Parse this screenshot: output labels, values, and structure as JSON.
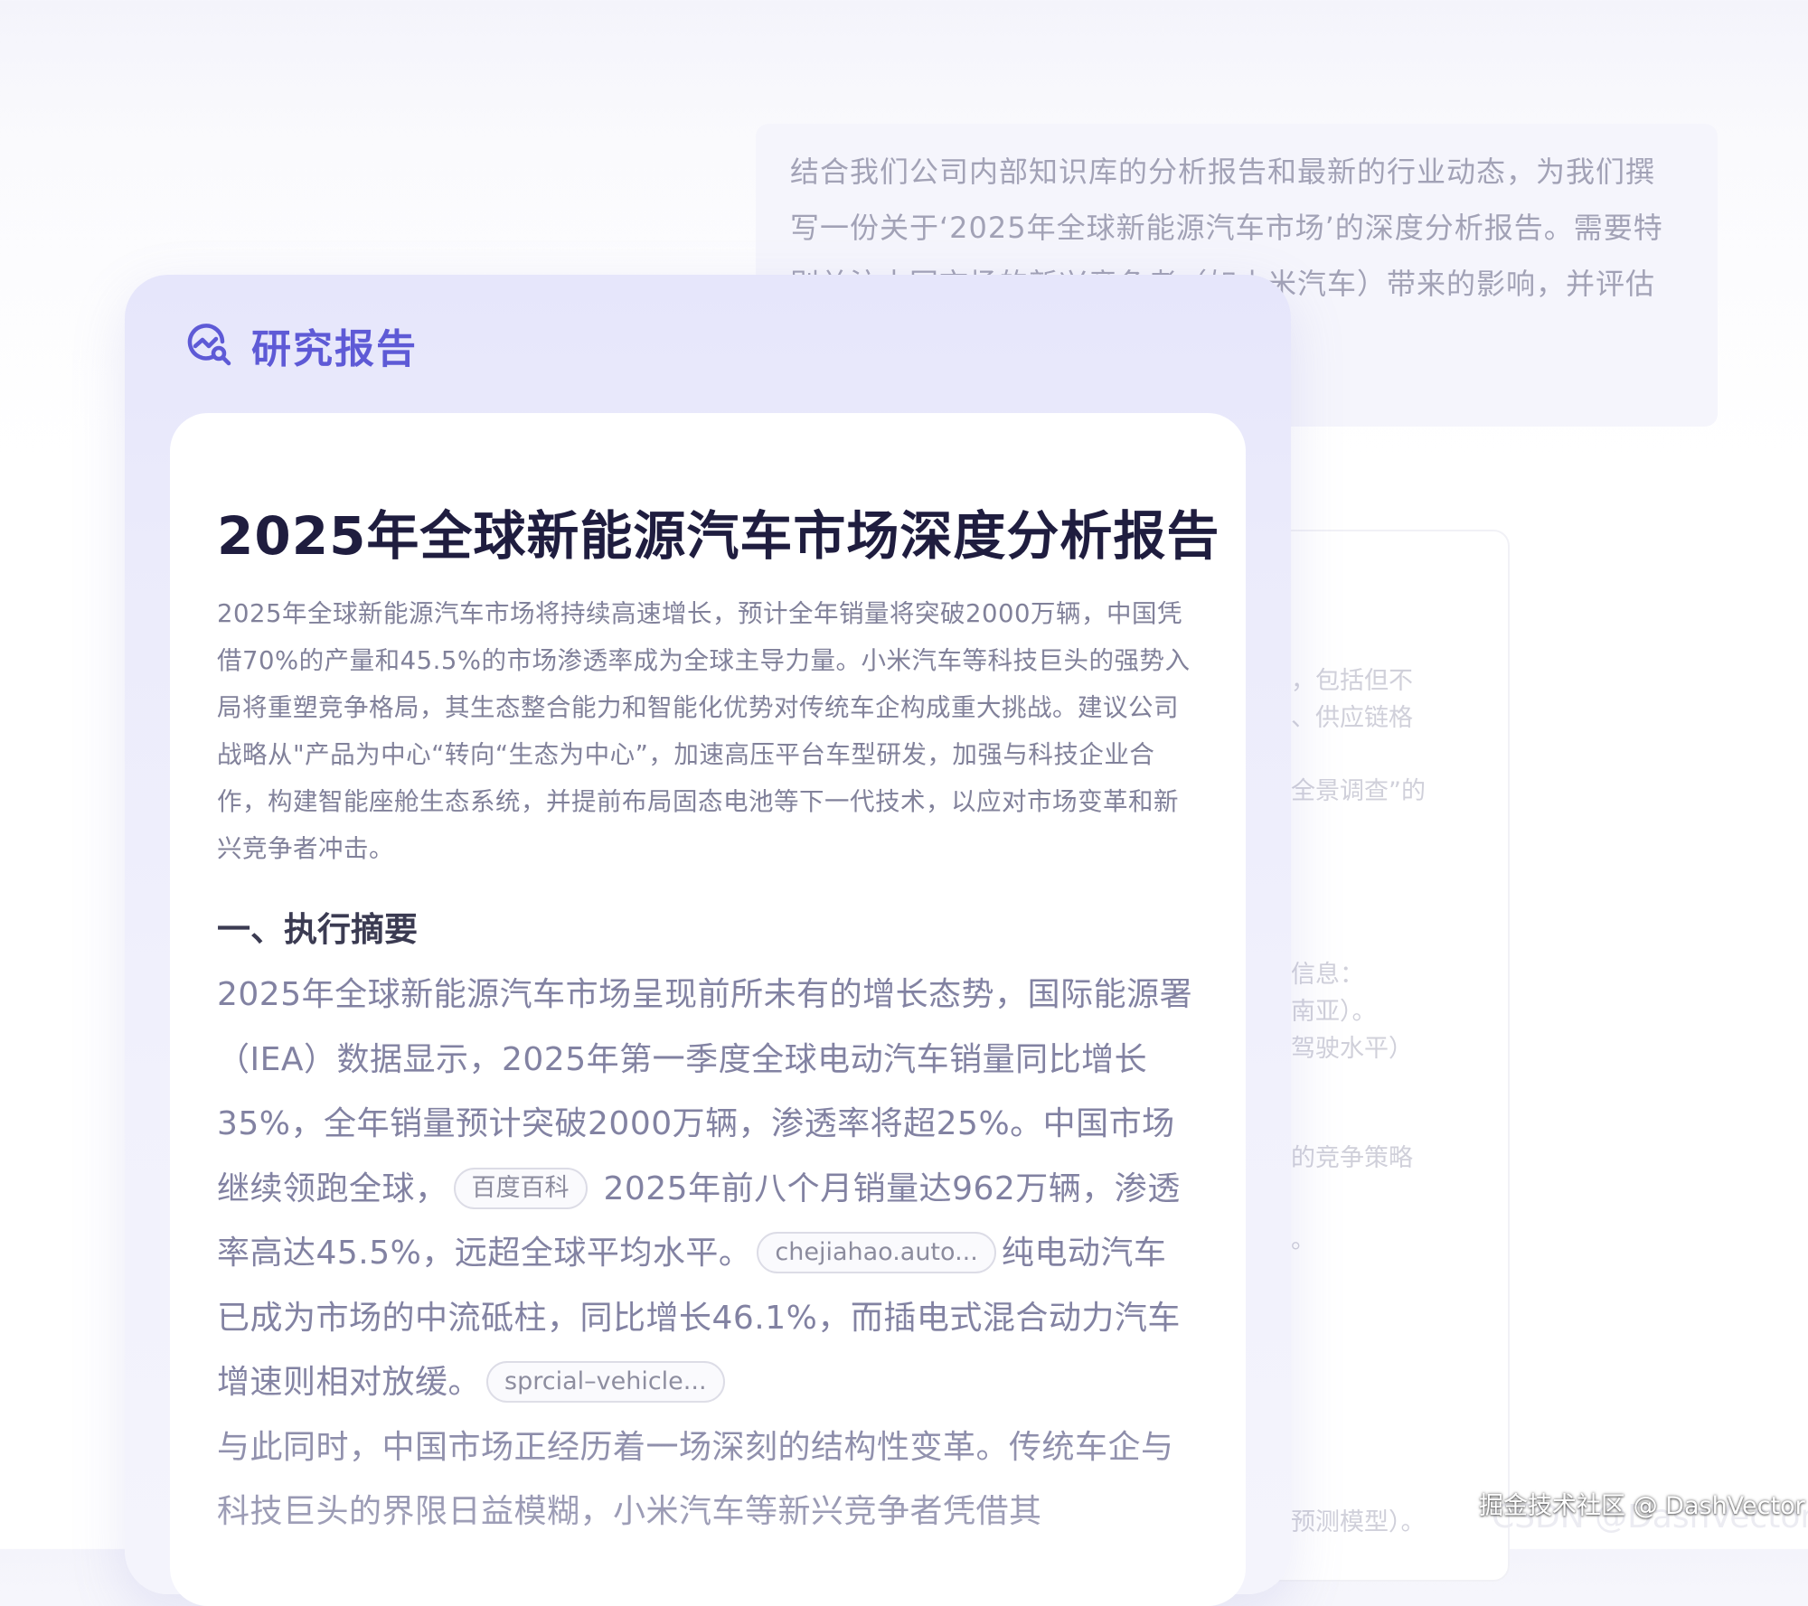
{
  "prompt": {
    "text": "结合我们公司内部知识库的分析报告和最新的行业动态，为我们撰写一份关于‘2025年全球新能源汽车市场’的深度分析报告。需要特别关注中国市场的新兴竞争者（如小米汽车）带来的影响，并评估刚刚获取到的这份第三方市场"
  },
  "background_card": {
    "lines": [
      "，包括但不",
      "、供应链格",
      "全景调查”的",
      "信息：",
      "南亚）。",
      "驾驶水平）",
      "的竞争策略",
      "。",
      "预测模型）。"
    ]
  },
  "report": {
    "panel_title": "研究报告",
    "icon": "chart-search-icon",
    "doc_title": "2025年全球新能源汽车市场深度分析报告",
    "summary": "2025年全球新能源汽车市场将持续高速增长，预计全年销量将突破2000万辆，中国凭借70%的产量和45.5%的市场渗透率成为全球主导力量。小米汽车等科技巨头的强势入局将重塑竞争格局，其生态整合能力和智能化优势对传统车企构成重大挑战。建议公司战略从\"产品为中心“转向“生态为中心”，加速高压平台车型研发，加强与科技企业合作，构建智能座舱生态系统，并提前布局固态电池等下一代技术，以应对市场变革和新兴竞争者冲击。",
    "section_heading": "一、执行摘要",
    "para1": {
      "seg1": "2025年全球新能源汽车市场呈现前所未有的增长态势，国际能源署（IEA）数据显示，2025年第一季度全球电动汽车销量同比增长35%，全年销量预计突破2000万辆，渗透率将超25%。中国市场继续领跑全球，",
      "cite1": "百度百科",
      "seg2": " 2025年前八个月销量达962万辆，渗透率高达45.5%，远超全球平均水平。",
      "cite2": "chejiahao.auto...",
      "seg3": "纯电动汽车已成为市场的中流砥柱，同比增长46.1%，而插电式混合动力汽车增速则相对放缓。",
      "cite3": "sprcial–vehicle..."
    },
    "para2": "与此同时，中国市场正经历着一场深刻的结构性变革。传统车企与科技巨头的界限日益模糊，小米汽车等新兴竞争者凭借其"
  },
  "watermark": {
    "main": "掘金技术社区 @ DashVector",
    "shadow": "CSDN @DashVector"
  },
  "colors": {
    "accent": "#5e5ad6",
    "title": "#1f1d3f",
    "body": "#8282a2",
    "panel_bg": "#e6e6fb"
  }
}
